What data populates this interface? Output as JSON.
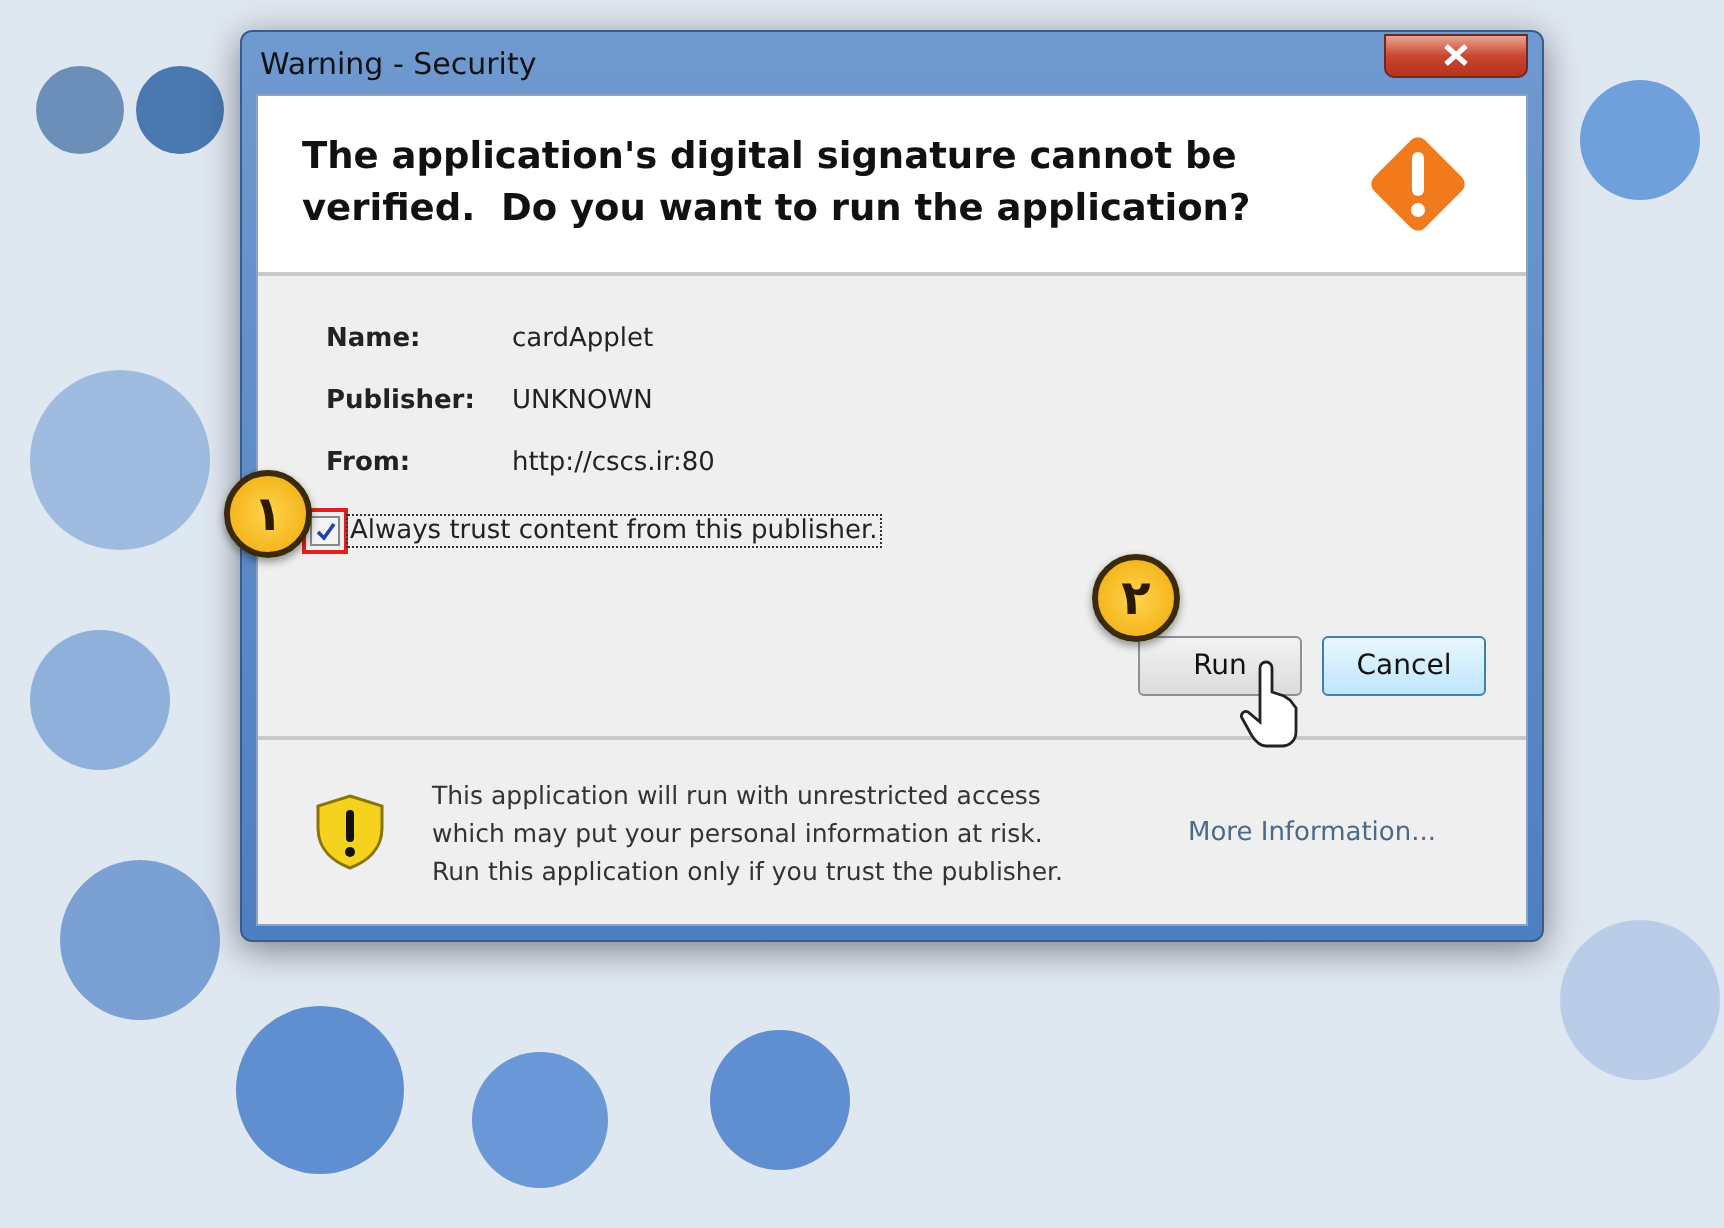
{
  "window": {
    "title": "Warning - Security"
  },
  "heading": "The application's digital signature cannot be verified.  Do you want to run the application?",
  "details": [
    {
      "label": "Name:",
      "value": "cardApplet"
    },
    {
      "label": "Publisher:",
      "value": "UNKNOWN"
    },
    {
      "label": "From:",
      "value": "http://cscs.ir:80"
    }
  ],
  "trust_checkbox": {
    "label": "Always trust content from this publisher.",
    "checked": true
  },
  "buttons": [
    {
      "label": "Run",
      "focused": false
    },
    {
      "label": "Cancel",
      "focused": true
    }
  ],
  "warning": {
    "text": "This application will run with unrestricted access\nwhich may put your personal information at risk.\nRun this application only if you trust the publisher.",
    "link": "More Information..."
  },
  "step_markers": [
    {
      "label": "۱"
    },
    {
      "label": "۲"
    }
  ]
}
